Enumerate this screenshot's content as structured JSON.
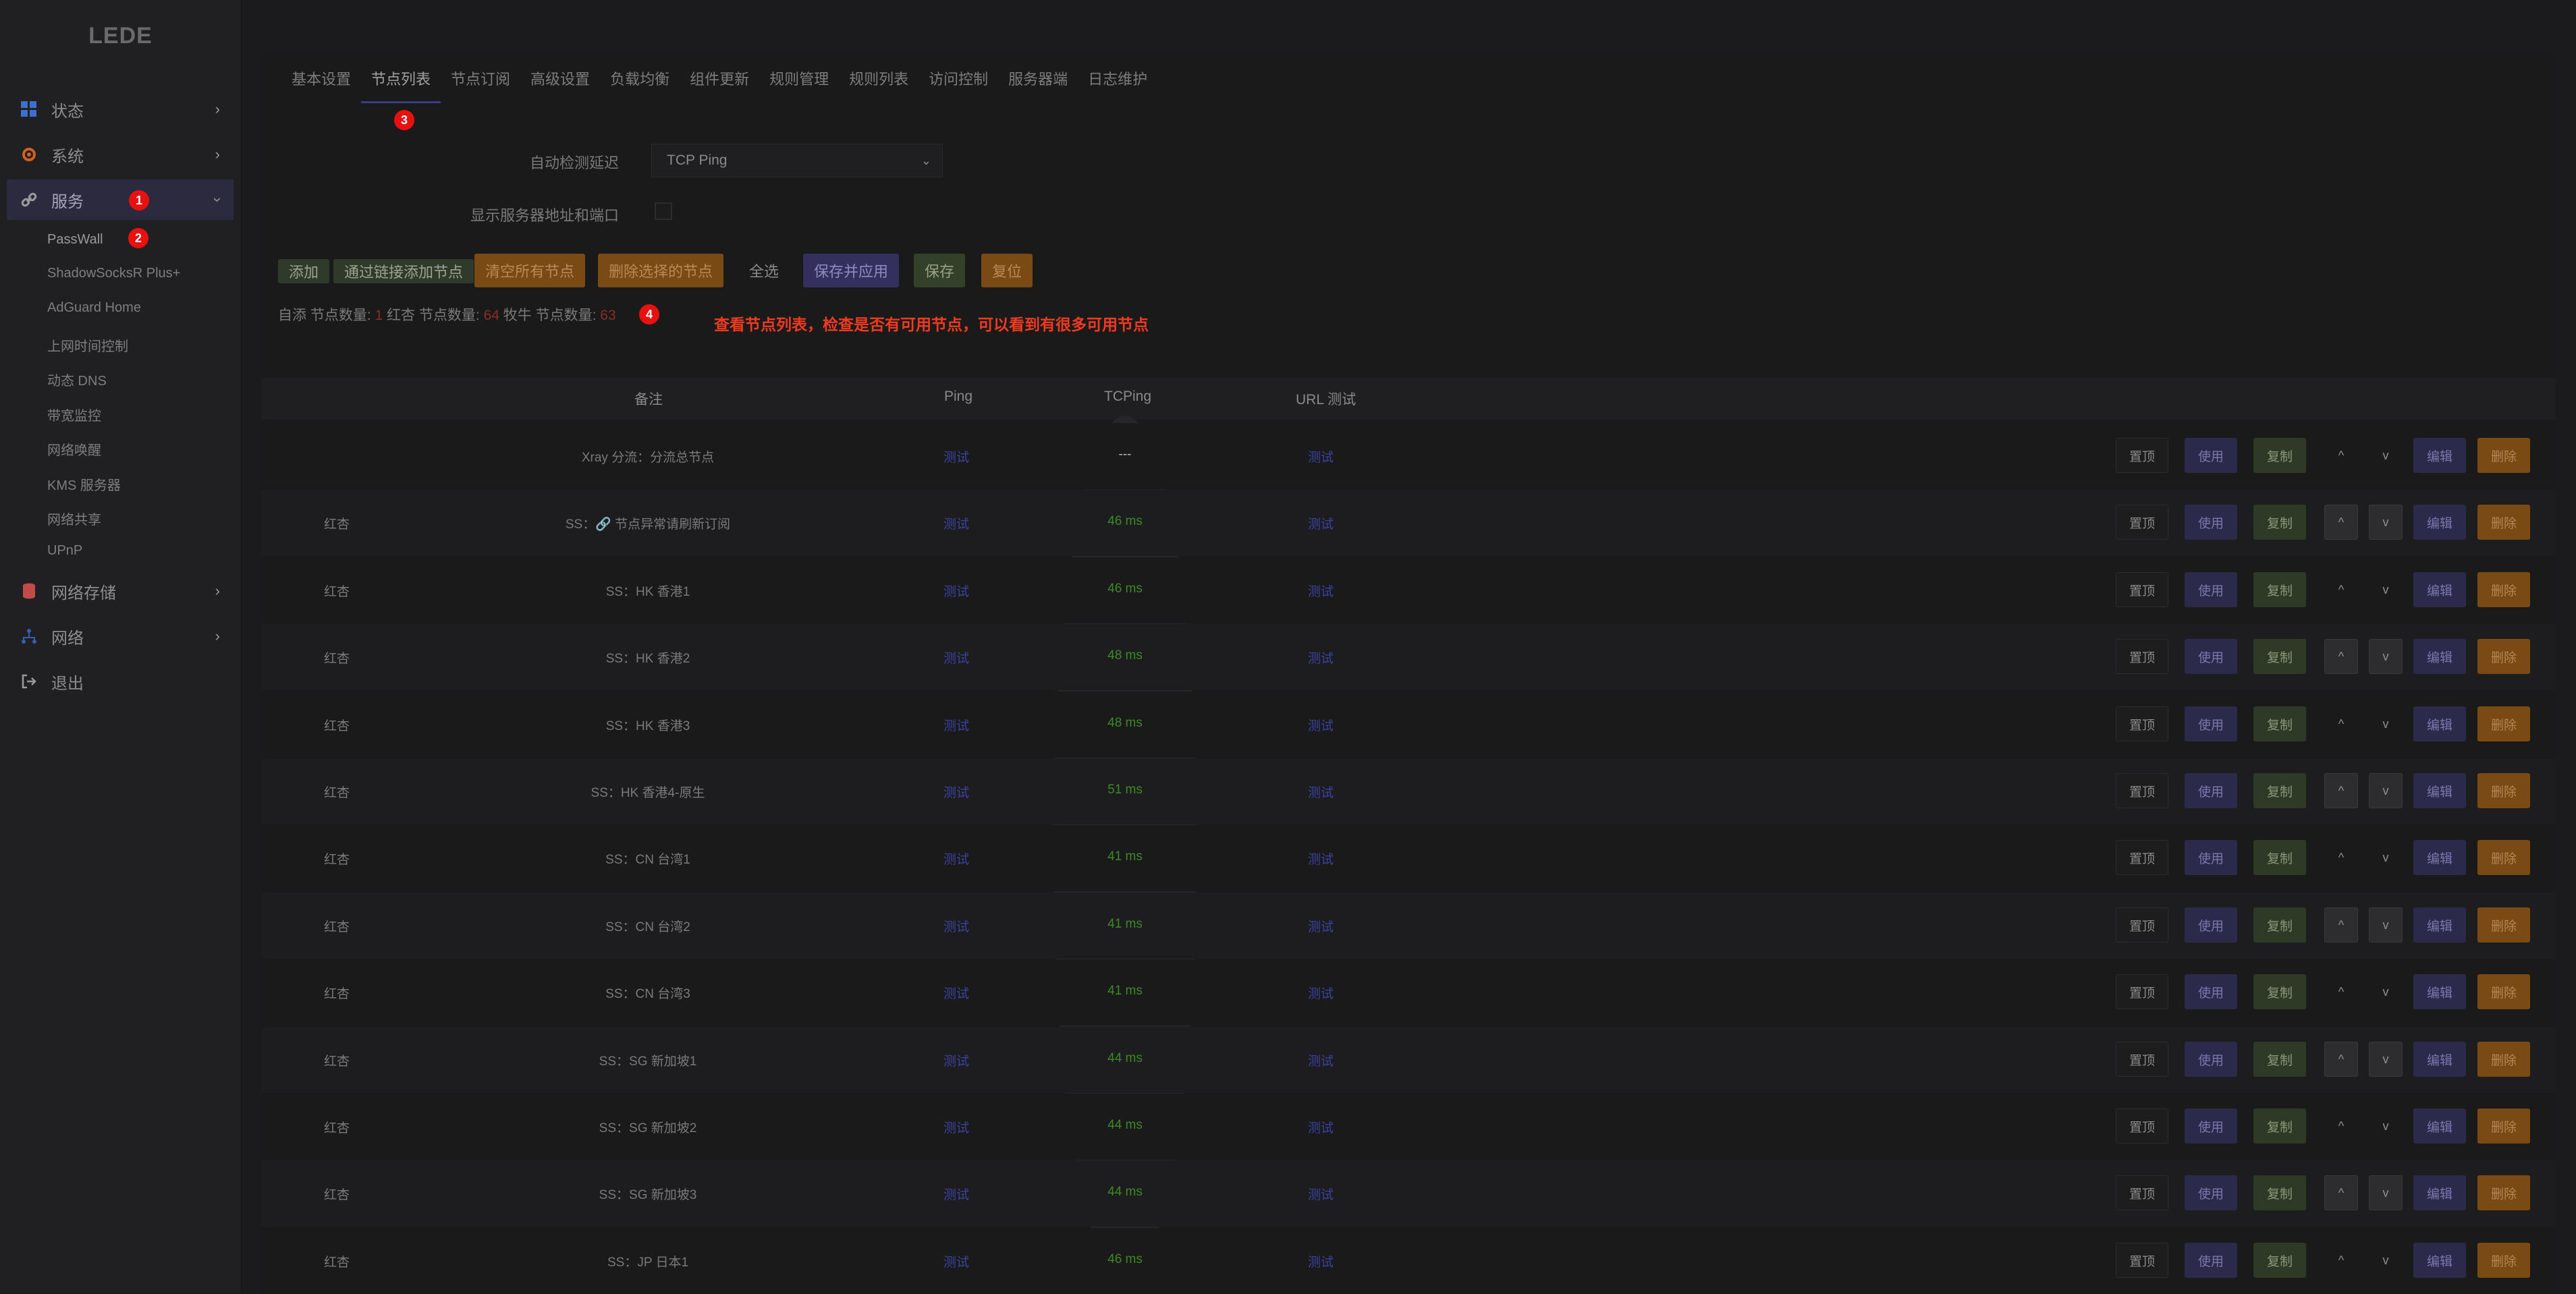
{
  "logo": "LEDE",
  "nav": [
    {
      "label": "状态",
      "icon": "grid-icon",
      "color": "#3d6fd0"
    },
    {
      "label": "系统",
      "icon": "gear-icon",
      "color": "#d0601e"
    },
    {
      "label": "服务",
      "icon": "link-icon",
      "color": "#9b9b9b"
    },
    {
      "label": "网络存储",
      "icon": "database-icon",
      "color": "#c24a4a"
    },
    {
      "label": "网络",
      "icon": "network-icon",
      "color": "#3a5bb5"
    },
    {
      "label": "退出",
      "icon": "exit-icon",
      "color": "#9b9b9b"
    }
  ],
  "services_sub": [
    "PassWall",
    "ShadowSocksR Plus+",
    "AdGuard Home",
    "上网时间控制",
    "动态 DNS",
    "带宽监控",
    "网络唤醒",
    "KMS 服务器",
    "网络共享",
    "UPnP"
  ],
  "badges": [
    "1",
    "2",
    "3",
    "4"
  ],
  "tabs": [
    "基本设置",
    "节点列表",
    "节点订阅",
    "高级设置",
    "负载均衡",
    "组件更新",
    "规则管理",
    "规则列表",
    "访问控制",
    "服务器端",
    "日志维护"
  ],
  "form": {
    "auto_detect_label": "自动检测延迟",
    "auto_detect_value": "TCP Ping",
    "show_addr_label": "显示服务器地址和端口"
  },
  "buttons": {
    "add": "添加",
    "add_link": "通过链接添加节点",
    "clear_all": "清空所有节点",
    "delete_selected": "删除选择的节点",
    "select_all": "全选",
    "save_apply": "保存并应用",
    "save": "保存",
    "reset": "复位"
  },
  "stats": {
    "self_label": "自添 节点数量:",
    "self_count": "1",
    "hx_label": "红杏 节点数量:",
    "hx_count": "64",
    "mn_label": "牧牛 节点数量:",
    "mn_count": "63"
  },
  "annotation": "查看节点列表，检查是否有可用节点，可以看到有很多可用节点",
  "table": {
    "headers": {
      "remark": "备注",
      "ping": "Ping",
      "tcping": "TCPing",
      "url": "URL 测试"
    },
    "test_label": "测试",
    "actions": {
      "top": "置顶",
      "use": "使用",
      "copy": "复制",
      "up": "^",
      "down": "v",
      "edit": "编辑",
      "delete": "删除"
    },
    "rows": [
      {
        "group": "",
        "remark": "Xray 分流：分流总节点",
        "tcping": "---"
      },
      {
        "group": "红杏",
        "remark": "SS：🔗 节点异常请刷新订阅",
        "tcping": "46 ms"
      },
      {
        "group": "红杏",
        "remark": "SS：HK 香港1",
        "tcping": "46 ms"
      },
      {
        "group": "红杏",
        "remark": "SS：HK 香港2",
        "tcping": "48 ms"
      },
      {
        "group": "红杏",
        "remark": "SS：HK 香港3",
        "tcping": "48 ms"
      },
      {
        "group": "红杏",
        "remark": "SS：HK 香港4-原生",
        "tcping": "51 ms"
      },
      {
        "group": "红杏",
        "remark": "SS：CN 台湾1",
        "tcping": "41 ms"
      },
      {
        "group": "红杏",
        "remark": "SS：CN 台湾2",
        "tcping": "41 ms"
      },
      {
        "group": "红杏",
        "remark": "SS：CN 台湾3",
        "tcping": "41 ms"
      },
      {
        "group": "红杏",
        "remark": "SS：SG 新加坡1",
        "tcping": "44 ms"
      },
      {
        "group": "红杏",
        "remark": "SS：SG 新加坡2",
        "tcping": "44 ms"
      },
      {
        "group": "红杏",
        "remark": "SS：SG 新加坡3",
        "tcping": "44 ms"
      },
      {
        "group": "红杏",
        "remark": "SS：JP 日本1",
        "tcping": "46 ms"
      }
    ]
  }
}
